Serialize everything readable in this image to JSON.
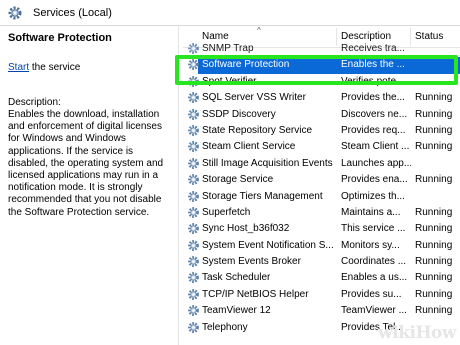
{
  "window": {
    "title": "Services (Local)",
    "icon": "gear-icon"
  },
  "left_pane": {
    "heading": "Software Protection",
    "action_link": "Start",
    "action_rest": " the service",
    "description_label": "Description:",
    "description_text": "Enables the download, installation and enforcement of digital licenses for Windows and Windows applications. If the service is disabled, the operating system and licensed applications may run in a notification mode. It is strongly recommended that you not disable the Software Protection service."
  },
  "table": {
    "columns": [
      "Name",
      "Description",
      "Status"
    ],
    "rows": [
      {
        "name": "SNMP Trap",
        "description": "Receives tra...",
        "status": ""
      },
      {
        "name": "Software Protection",
        "description": "Enables the ...",
        "status": ""
      },
      {
        "name": "Spot Verifier",
        "description": "Verifies pote...",
        "status": ""
      },
      {
        "name": "SQL Server VSS Writer",
        "description": "Provides the...",
        "status": "Running"
      },
      {
        "name": "SSDP Discovery",
        "description": "Discovers ne...",
        "status": "Running"
      },
      {
        "name": "State Repository Service",
        "description": "Provides req...",
        "status": "Running"
      },
      {
        "name": "Steam Client Service",
        "description": "Steam Client ...",
        "status": "Running"
      },
      {
        "name": "Still Image Acquisition Events",
        "description": "Launches app...",
        "status": ""
      },
      {
        "name": "Storage Service",
        "description": "Provides ena...",
        "status": "Running"
      },
      {
        "name": "Storage Tiers Management",
        "description": "Optimizes th...",
        "status": ""
      },
      {
        "name": "Superfetch",
        "description": "Maintains a...",
        "status": "Running"
      },
      {
        "name": "Sync Host_b36f032",
        "description": "This service ...",
        "status": "Running"
      },
      {
        "name": "System Event Notification S...",
        "description": "Monitors sy...",
        "status": "Running"
      },
      {
        "name": "System Events Broker",
        "description": "Coordinates ...",
        "status": "Running"
      },
      {
        "name": "Task Scheduler",
        "description": "Enables a us...",
        "status": "Running"
      },
      {
        "name": "TCP/IP NetBIOS Helper",
        "description": "Provides su...",
        "status": "Running"
      },
      {
        "name": "TeamViewer 12",
        "description": "TeamViewer ...",
        "status": "Running"
      },
      {
        "name": "Telephony",
        "description": "Provides Tel...",
        "status": ""
      }
    ],
    "selected_index": 1
  },
  "colors": {
    "selection": "#0a69d6",
    "highlight_box": "#27e51e"
  },
  "watermark": "wikiHow"
}
